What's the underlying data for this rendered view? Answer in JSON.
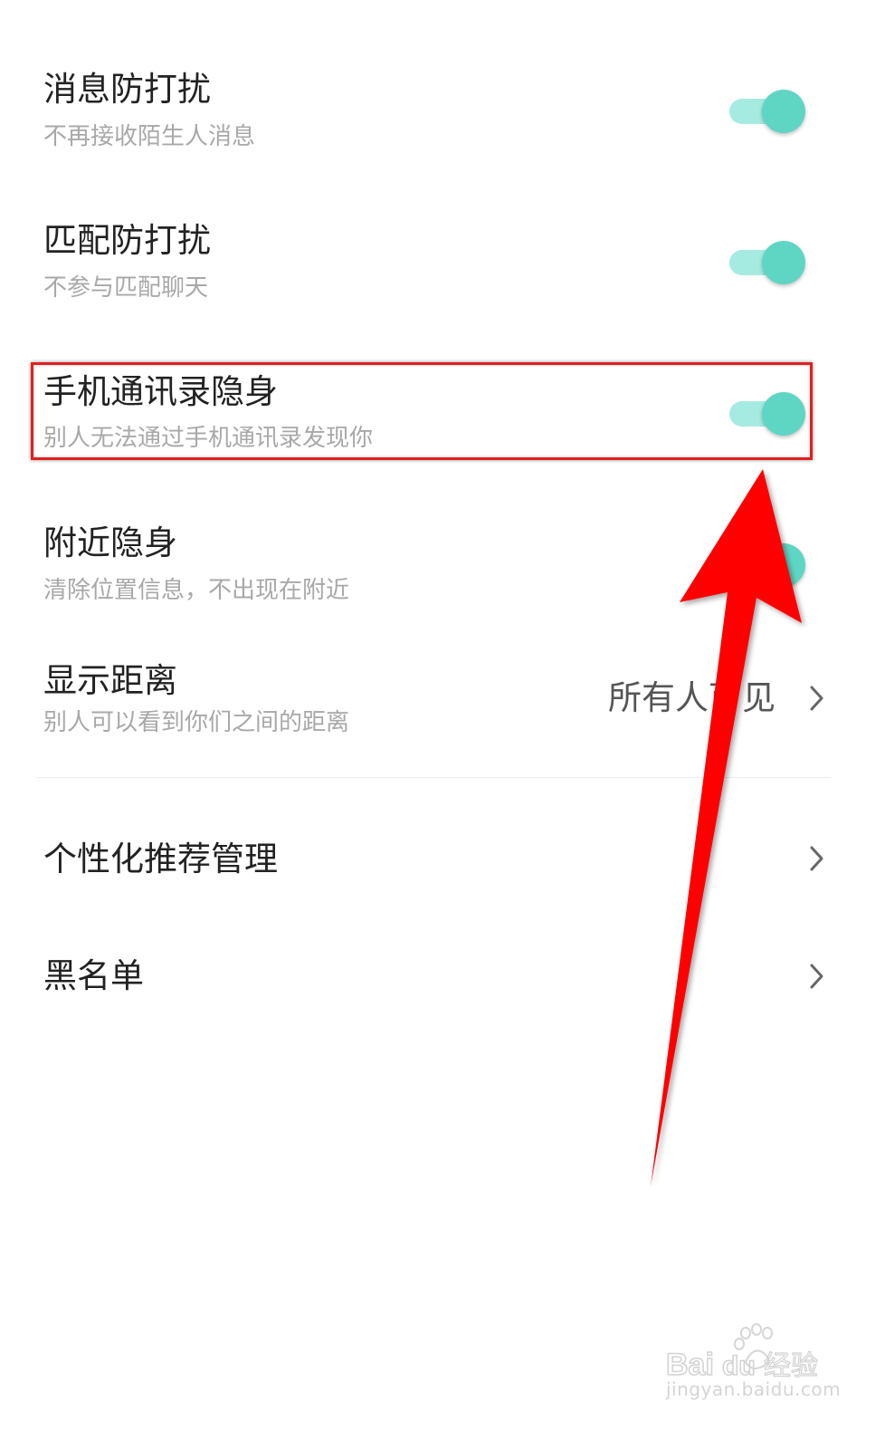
{
  "settings": {
    "items": [
      {
        "title": "消息防打扰",
        "subtitle": "不再接收陌生人消息",
        "toggle_on": true
      },
      {
        "title": "匹配防打扰",
        "subtitle": "不参与匹配聊天",
        "toggle_on": true
      },
      {
        "title": "手机通讯录隐身",
        "subtitle": "别人无法通过手机通讯录发现你",
        "toggle_on": true
      },
      {
        "title": "附近隐身",
        "subtitle": "清除位置信息，不出现在附近",
        "toggle_on": true
      },
      {
        "title": "显示距离",
        "subtitle": "别人可以看到你们之间的距离",
        "value": "所有人可见",
        "icon": "chevron-right-icon"
      }
    ],
    "nav_items": [
      {
        "title": "个性化推荐管理",
        "icon": "chevron-right-icon"
      },
      {
        "title": "黑名单",
        "icon": "chevron-right-icon"
      }
    ]
  },
  "colors": {
    "accent": "#5fd6c4",
    "track": "#a6ebe1",
    "highlight": "#e02020",
    "arrow": "#ff0000"
  },
  "watermark": {
    "text": "jingyan.baidu.com"
  }
}
